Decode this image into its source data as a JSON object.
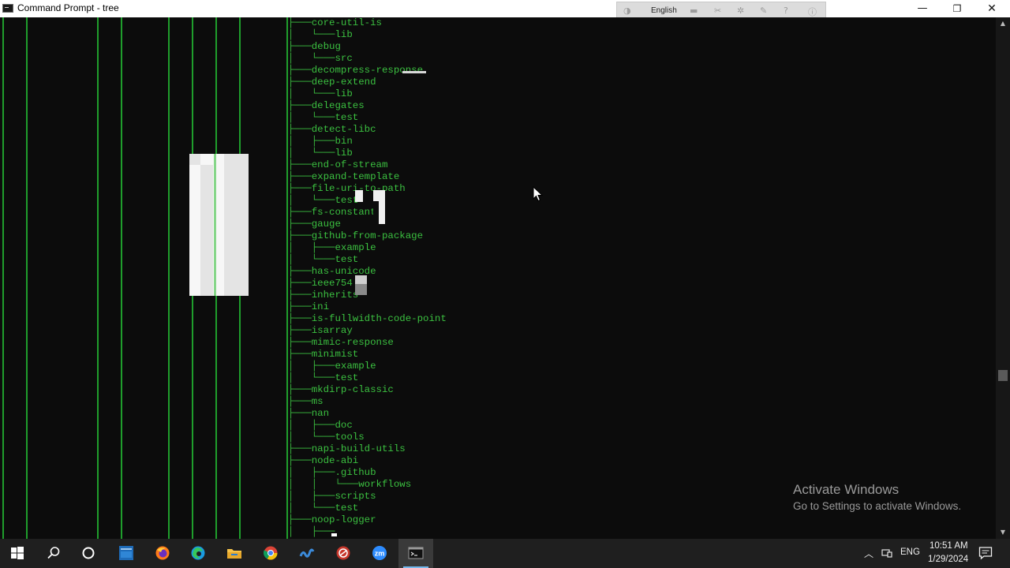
{
  "window": {
    "title": "Command Prompt - tree",
    "minimize_glyph": "—",
    "maximize_glyph": "❐",
    "close_glyph": "✕"
  },
  "language_bar": {
    "language": "English"
  },
  "console": {
    "text_color": "#3bc040",
    "rows": [
      {
        "prefix": "├───",
        "name": "core-util-is"
      },
      {
        "prefix": "│   └───",
        "name": "lib"
      },
      {
        "prefix": "├───",
        "name": "debug"
      },
      {
        "prefix": "│   └───",
        "name": "src"
      },
      {
        "prefix": "├───",
        "name": "decompress-response"
      },
      {
        "prefix": "├───",
        "name": "deep-extend"
      },
      {
        "prefix": "│   └───",
        "name": "lib"
      },
      {
        "prefix": "├───",
        "name": "delegates"
      },
      {
        "prefix": "│   └───",
        "name": "test"
      },
      {
        "prefix": "├───",
        "name": "detect-libc"
      },
      {
        "prefix": "│   ├───",
        "name": "bin"
      },
      {
        "prefix": "│   └───",
        "name": "lib"
      },
      {
        "prefix": "├───",
        "name": "end-of-stream"
      },
      {
        "prefix": "├───",
        "name": "expand-template"
      },
      {
        "prefix": "├───",
        "name": "file-uri-to-path"
      },
      {
        "prefix": "│   └───",
        "name": "test"
      },
      {
        "prefix": "├───",
        "name": "fs-constants"
      },
      {
        "prefix": "├───",
        "name": "gauge"
      },
      {
        "prefix": "├───",
        "name": "github-from-package"
      },
      {
        "prefix": "│   ├───",
        "name": "example"
      },
      {
        "prefix": "│   └───",
        "name": "test"
      },
      {
        "prefix": "├───",
        "name": "has-unicode"
      },
      {
        "prefix": "├───",
        "name": "ieee754"
      },
      {
        "prefix": "├───",
        "name": "inherits"
      },
      {
        "prefix": "├───",
        "name": "ini"
      },
      {
        "prefix": "├───",
        "name": "is-fullwidth-code-point"
      },
      {
        "prefix": "├───",
        "name": "isarray"
      },
      {
        "prefix": "├───",
        "name": "mimic-response"
      },
      {
        "prefix": "├───",
        "name": "minimist"
      },
      {
        "prefix": "│   ├───",
        "name": "example"
      },
      {
        "prefix": "│   └───",
        "name": "test"
      },
      {
        "prefix": "├───",
        "name": "mkdirp-classic"
      },
      {
        "prefix": "├───",
        "name": "ms"
      },
      {
        "prefix": "├───",
        "name": "nan"
      },
      {
        "prefix": "│   ├───",
        "name": "doc"
      },
      {
        "prefix": "│   └───",
        "name": "tools"
      },
      {
        "prefix": "├───",
        "name": "napi-build-utils"
      },
      {
        "prefix": "├───",
        "name": "node-abi"
      },
      {
        "prefix": "│   ├───",
        "name": ".github"
      },
      {
        "prefix": "│   │   └───",
        "name": "workflows"
      },
      {
        "prefix": "│   ├───",
        "name": "scripts"
      },
      {
        "prefix": "│   └───",
        "name": "test"
      },
      {
        "prefix": "├───",
        "name": "noop-logger"
      },
      {
        "prefix": "│   ├───",
        "name": ""
      }
    ]
  },
  "watermark": {
    "title": "Activate Windows",
    "subtitle": "Go to Settings to activate Windows."
  },
  "taskbar": {
    "apps": [
      {
        "name": "start",
        "icon": "windows-logo-icon"
      },
      {
        "name": "search",
        "icon": "search-icon"
      },
      {
        "name": "task-view",
        "icon": "cortana-circle-icon"
      },
      {
        "name": "app-blue",
        "icon": "blue-app-icon"
      },
      {
        "name": "firefox",
        "icon": "firefox-icon"
      },
      {
        "name": "edge",
        "icon": "edge-icon"
      },
      {
        "name": "file-explorer",
        "icon": "folder-icon"
      },
      {
        "name": "chrome",
        "icon": "chrome-icon"
      },
      {
        "name": "app-wave",
        "icon": "wave-app-icon"
      },
      {
        "name": "app-red",
        "icon": "red-app-icon"
      },
      {
        "name": "zoom",
        "icon": "zoom-icon"
      },
      {
        "name": "command-prompt",
        "icon": "terminal-icon"
      }
    ],
    "zoom_label": "zm",
    "tray": {
      "language": "ENG",
      "time": "10:51 AM",
      "date": "1/29/2024"
    }
  }
}
